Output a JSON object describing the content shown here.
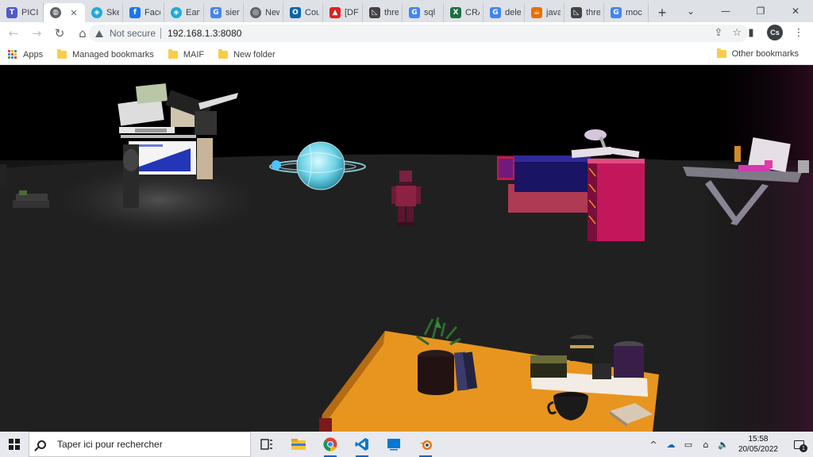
{
  "tabs": [
    {
      "title": "PICI",
      "favicon": "teams-icon",
      "color": "#5059c9",
      "glyph": "T",
      "active": false
    },
    {
      "title": "",
      "favicon": "globe-icon",
      "color": "#5f6368",
      "glyph": "◍",
      "active": true,
      "close": "✕"
    },
    {
      "title": "Sket",
      "favicon": "sketchfab-icon",
      "color": "#1caad9",
      "glyph": "◈",
      "active": false
    },
    {
      "title": "Face",
      "favicon": "facebook-icon",
      "color": "#1877f2",
      "glyph": "f",
      "active": false
    },
    {
      "title": "Earth",
      "favicon": "sketchfab-icon",
      "color": "#1caad9",
      "glyph": "◈",
      "active": false
    },
    {
      "title": "sierr",
      "favicon": "google-icon",
      "color": "#4285f4",
      "glyph": "G",
      "active": false
    },
    {
      "title": "New",
      "favicon": "chrome-icon",
      "color": "#5f6368",
      "glyph": "◎",
      "active": false
    },
    {
      "title": "Cou",
      "favicon": "outlook-icon",
      "color": "#0a64ad",
      "glyph": "O",
      "active": false
    },
    {
      "title": "[DF]",
      "favicon": "deepl-icon",
      "color": "#e02020",
      "glyph": "▲",
      "active": false
    },
    {
      "title": "thre",
      "favicon": "threejs-icon",
      "color": "#444444",
      "glyph": "◺",
      "active": false
    },
    {
      "title": "sql",
      "favicon": "google-icon",
      "color": "#4285f4",
      "glyph": "G",
      "active": false
    },
    {
      "title": "CRA",
      "favicon": "excel-icon",
      "color": "#1d6f42",
      "glyph": "X",
      "active": false
    },
    {
      "title": "dele",
      "favicon": "google-icon",
      "color": "#4285f4",
      "glyph": "G",
      "active": false
    },
    {
      "title": "java",
      "favicon": "java-icon",
      "color": "#e76f00",
      "glyph": "☕",
      "active": false
    },
    {
      "title": "thre",
      "favicon": "threejs-icon",
      "color": "#444444",
      "glyph": "◺",
      "active": false
    },
    {
      "title": "moc",
      "favicon": "google-icon",
      "color": "#4285f4",
      "glyph": "G",
      "active": false
    }
  ],
  "new_tab": "+",
  "window_controls": {
    "minimize": "⌄",
    "min2": "—",
    "restore": "❐",
    "close": "✕"
  },
  "toolbar": {
    "back": "←",
    "forward": "→",
    "reload": "↻",
    "home": "⌂",
    "security_label": "Not secure",
    "url": "192.168.1.3:8080",
    "share": "⇪",
    "star": "☆",
    "sidebar": "▮",
    "avatar_initials": "Cs",
    "menu": "⋮"
  },
  "bookmarks": {
    "apps": "Apps",
    "items": [
      "Managed bookmarks",
      "MAIF",
      "New folder"
    ],
    "other": "Other bookmarks"
  },
  "taskbar": {
    "search_placeholder": "Taper ici pour rechercher",
    "time": "15:58",
    "date": "20/05/2022",
    "notification_count": "1",
    "tray": {
      "chevron": "^",
      "cloud": "☁",
      "battery": "▭",
      "network": "⌂",
      "volume": "🔈"
    }
  },
  "scene": {
    "colors": {
      "floor": "#1f1f1f",
      "table": "#e8951f",
      "magenta": "#c2185b",
      "globe": "#7fe6ff",
      "avatar": "#8b2242",
      "chest": "#1a1464"
    }
  }
}
